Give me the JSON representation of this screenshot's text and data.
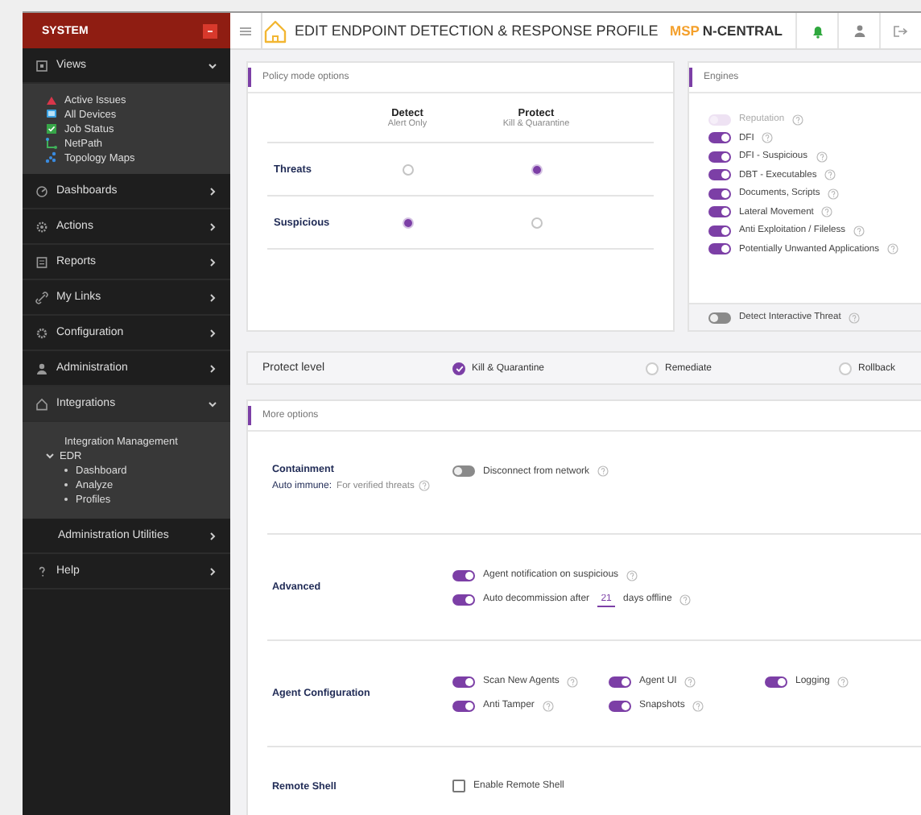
{
  "sidebar": {
    "title": "SYSTEM",
    "items": [
      {
        "label": "Views",
        "expanded": true,
        "selected": false,
        "children": [
          {
            "label": "Active Issues"
          },
          {
            "label": "All Devices"
          },
          {
            "label": "Job Status"
          },
          {
            "label": "NetPath"
          },
          {
            "label": "Topology Maps"
          }
        ]
      },
      {
        "label": "Dashboards",
        "expanded": false,
        "selected": false
      },
      {
        "label": "Actions",
        "expanded": false,
        "selected": false
      },
      {
        "label": "Reports",
        "expanded": false,
        "selected": false
      },
      {
        "label": "My Links",
        "expanded": false,
        "selected": false
      },
      {
        "label": "Configuration",
        "expanded": false,
        "selected": false
      },
      {
        "label": "Administration",
        "expanded": false,
        "selected": false
      },
      {
        "label": "Integrations",
        "expanded": true,
        "selected": true,
        "children": [
          {
            "label": "Integration Management"
          },
          {
            "label": "EDR",
            "expanded": true,
            "children": [
              {
                "label": "Dashboard"
              },
              {
                "label": "Analyze"
              },
              {
                "label": "Profiles"
              }
            ]
          }
        ]
      },
      {
        "label": "Administration Utilities",
        "expanded": false,
        "selected": false
      },
      {
        "label": "Help",
        "expanded": false,
        "selected": false
      }
    ]
  },
  "header": {
    "title": "EDIT ENDPOINT DETECTION & RESPONSE PROFILE",
    "brand_prefix": "MSP",
    "brand_name": "N-CENTRAL"
  },
  "policy": {
    "title": "Policy mode options",
    "columns": [
      {
        "label": "Detect",
        "sublabel": "Alert Only"
      },
      {
        "label": "Protect",
        "sublabel": "Kill & Quarantine"
      }
    ],
    "rows": [
      {
        "label": "Threats",
        "options": [
          {
            "selected": false
          },
          {
            "selected": true
          }
        ]
      },
      {
        "label": "Suspicious",
        "options": [
          {
            "selected": true
          },
          {
            "selected": false
          }
        ]
      }
    ]
  },
  "engines": {
    "title": "Engines",
    "items": [
      {
        "label": "Reputation",
        "on": false,
        "disabled": true
      },
      {
        "label": "DFI",
        "on": true,
        "disabled": false
      },
      {
        "label": "DFI - Suspicious",
        "on": true,
        "disabled": false
      },
      {
        "label": "DBT - Executables",
        "on": true,
        "disabled": false
      },
      {
        "label": "Documents, Scripts",
        "on": true,
        "disabled": false
      },
      {
        "label": "Lateral Movement",
        "on": true,
        "disabled": false
      },
      {
        "label": "Anti Exploitation / Fileless",
        "on": true,
        "disabled": false
      },
      {
        "label": "Potentially Unwanted Applications",
        "on": true,
        "disabled": false
      }
    ],
    "footer": {
      "label": "Detect Interactive Threat",
      "on": false
    }
  },
  "protect_level": {
    "label": "Protect level",
    "options": [
      {
        "label": "Kill & Quarantine",
        "selected": true
      },
      {
        "label": "Remediate",
        "selected": false
      },
      {
        "label": "Rollback",
        "selected": false
      }
    ]
  },
  "more_options": {
    "title": "More options",
    "sections": [
      {
        "label": "Containment",
        "note_label": "Auto immune:",
        "note_value": "For verified threats",
        "controls": [
          {
            "kind": "toggle",
            "label": "Disconnect from network",
            "on": false
          }
        ]
      },
      {
        "label": "Advanced",
        "controls": [
          {
            "kind": "toggle",
            "label": "Agent notification on suspicious",
            "on": true
          },
          {
            "kind": "days",
            "prefix": "Auto decommission after",
            "value": "21",
            "suffix": "days offline",
            "on": true
          }
        ]
      },
      {
        "label": "Agent Configuration",
        "controls": [
          {
            "kind": "toggle",
            "label": "Scan New Agents",
            "on": true
          },
          {
            "kind": "toggle",
            "label": "Agent UI",
            "on": true
          },
          {
            "kind": "toggle",
            "label": "Logging",
            "on": true
          },
          {
            "kind": "toggle",
            "label": "Anti Tamper",
            "on": true
          },
          {
            "kind": "toggle",
            "label": "Snapshots",
            "on": true
          }
        ]
      },
      {
        "label": "Remote Shell",
        "controls": [
          {
            "kind": "checkbox",
            "label": "Enable Remote Shell",
            "checked": false
          }
        ]
      }
    ]
  }
}
